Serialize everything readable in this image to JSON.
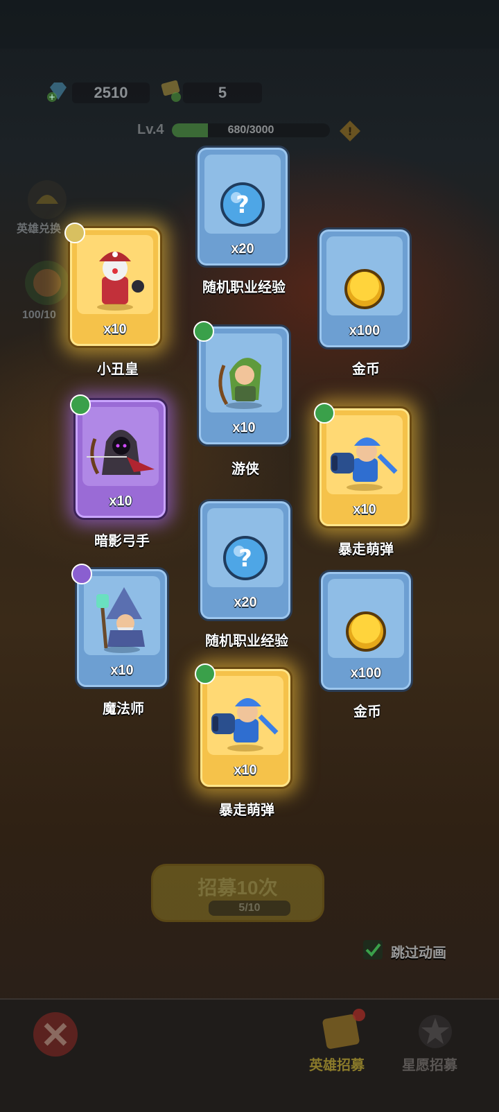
{
  "resources": {
    "gems": "2510",
    "tickets": "5"
  },
  "player": {
    "level": "Lv.4",
    "xp_text": "680/3000",
    "xp_progress": 0.227
  },
  "side_buttons": {
    "hero_exchange": "英雄兑换",
    "count": "100/10"
  },
  "cards": [
    {
      "name": "随机职业经验",
      "qty": "x20",
      "rarity": "blue",
      "icon": "question-orb-icon"
    },
    {
      "name": "小丑皇",
      "qty": "x10",
      "rarity": "gold",
      "icon": "clown-king-hero",
      "badge": "skull-icon"
    },
    {
      "name": "金币",
      "qty": "x100",
      "rarity": "blue",
      "icon": "gold-coin-icon"
    },
    {
      "name": "游侠",
      "qty": "x10",
      "rarity": "blue",
      "icon": "ranger-hero",
      "badge": "bow-icon"
    },
    {
      "name": "暗影弓手",
      "qty": "x10",
      "rarity": "purple",
      "icon": "shadow-archer-hero",
      "badge": "bow-icon"
    },
    {
      "name": "暴走萌弹",
      "qty": "x10",
      "rarity": "gold",
      "icon": "cannon-hero",
      "badge": "bow-icon"
    },
    {
      "name": "随机职业经验",
      "qty": "x20",
      "rarity": "blue",
      "icon": "question-orb-icon"
    },
    {
      "name": "魔法师",
      "qty": "x10",
      "rarity": "blue",
      "icon": "wizard-hero",
      "badge": "staff-icon"
    },
    {
      "name": "金币",
      "qty": "x100",
      "rarity": "blue",
      "icon": "gold-coin-icon"
    },
    {
      "name": "暴走萌弹",
      "qty": "x10",
      "rarity": "gold",
      "icon": "cannon-hero",
      "badge": "bow-icon"
    }
  ],
  "recruit": {
    "title": "招募10次",
    "progress": "5/10"
  },
  "skip_animation": "跳过动画",
  "tabs": {
    "hero_recruit": "英雄招募",
    "star_recruit": "星愿招募"
  },
  "colors": {
    "gold_card": "#f5c24a",
    "blue_card": "#6d9fd2",
    "purple_card": "#9a6bd6",
    "badge_green": "#3aa04a",
    "badge_purple": "#8a5fd0"
  }
}
